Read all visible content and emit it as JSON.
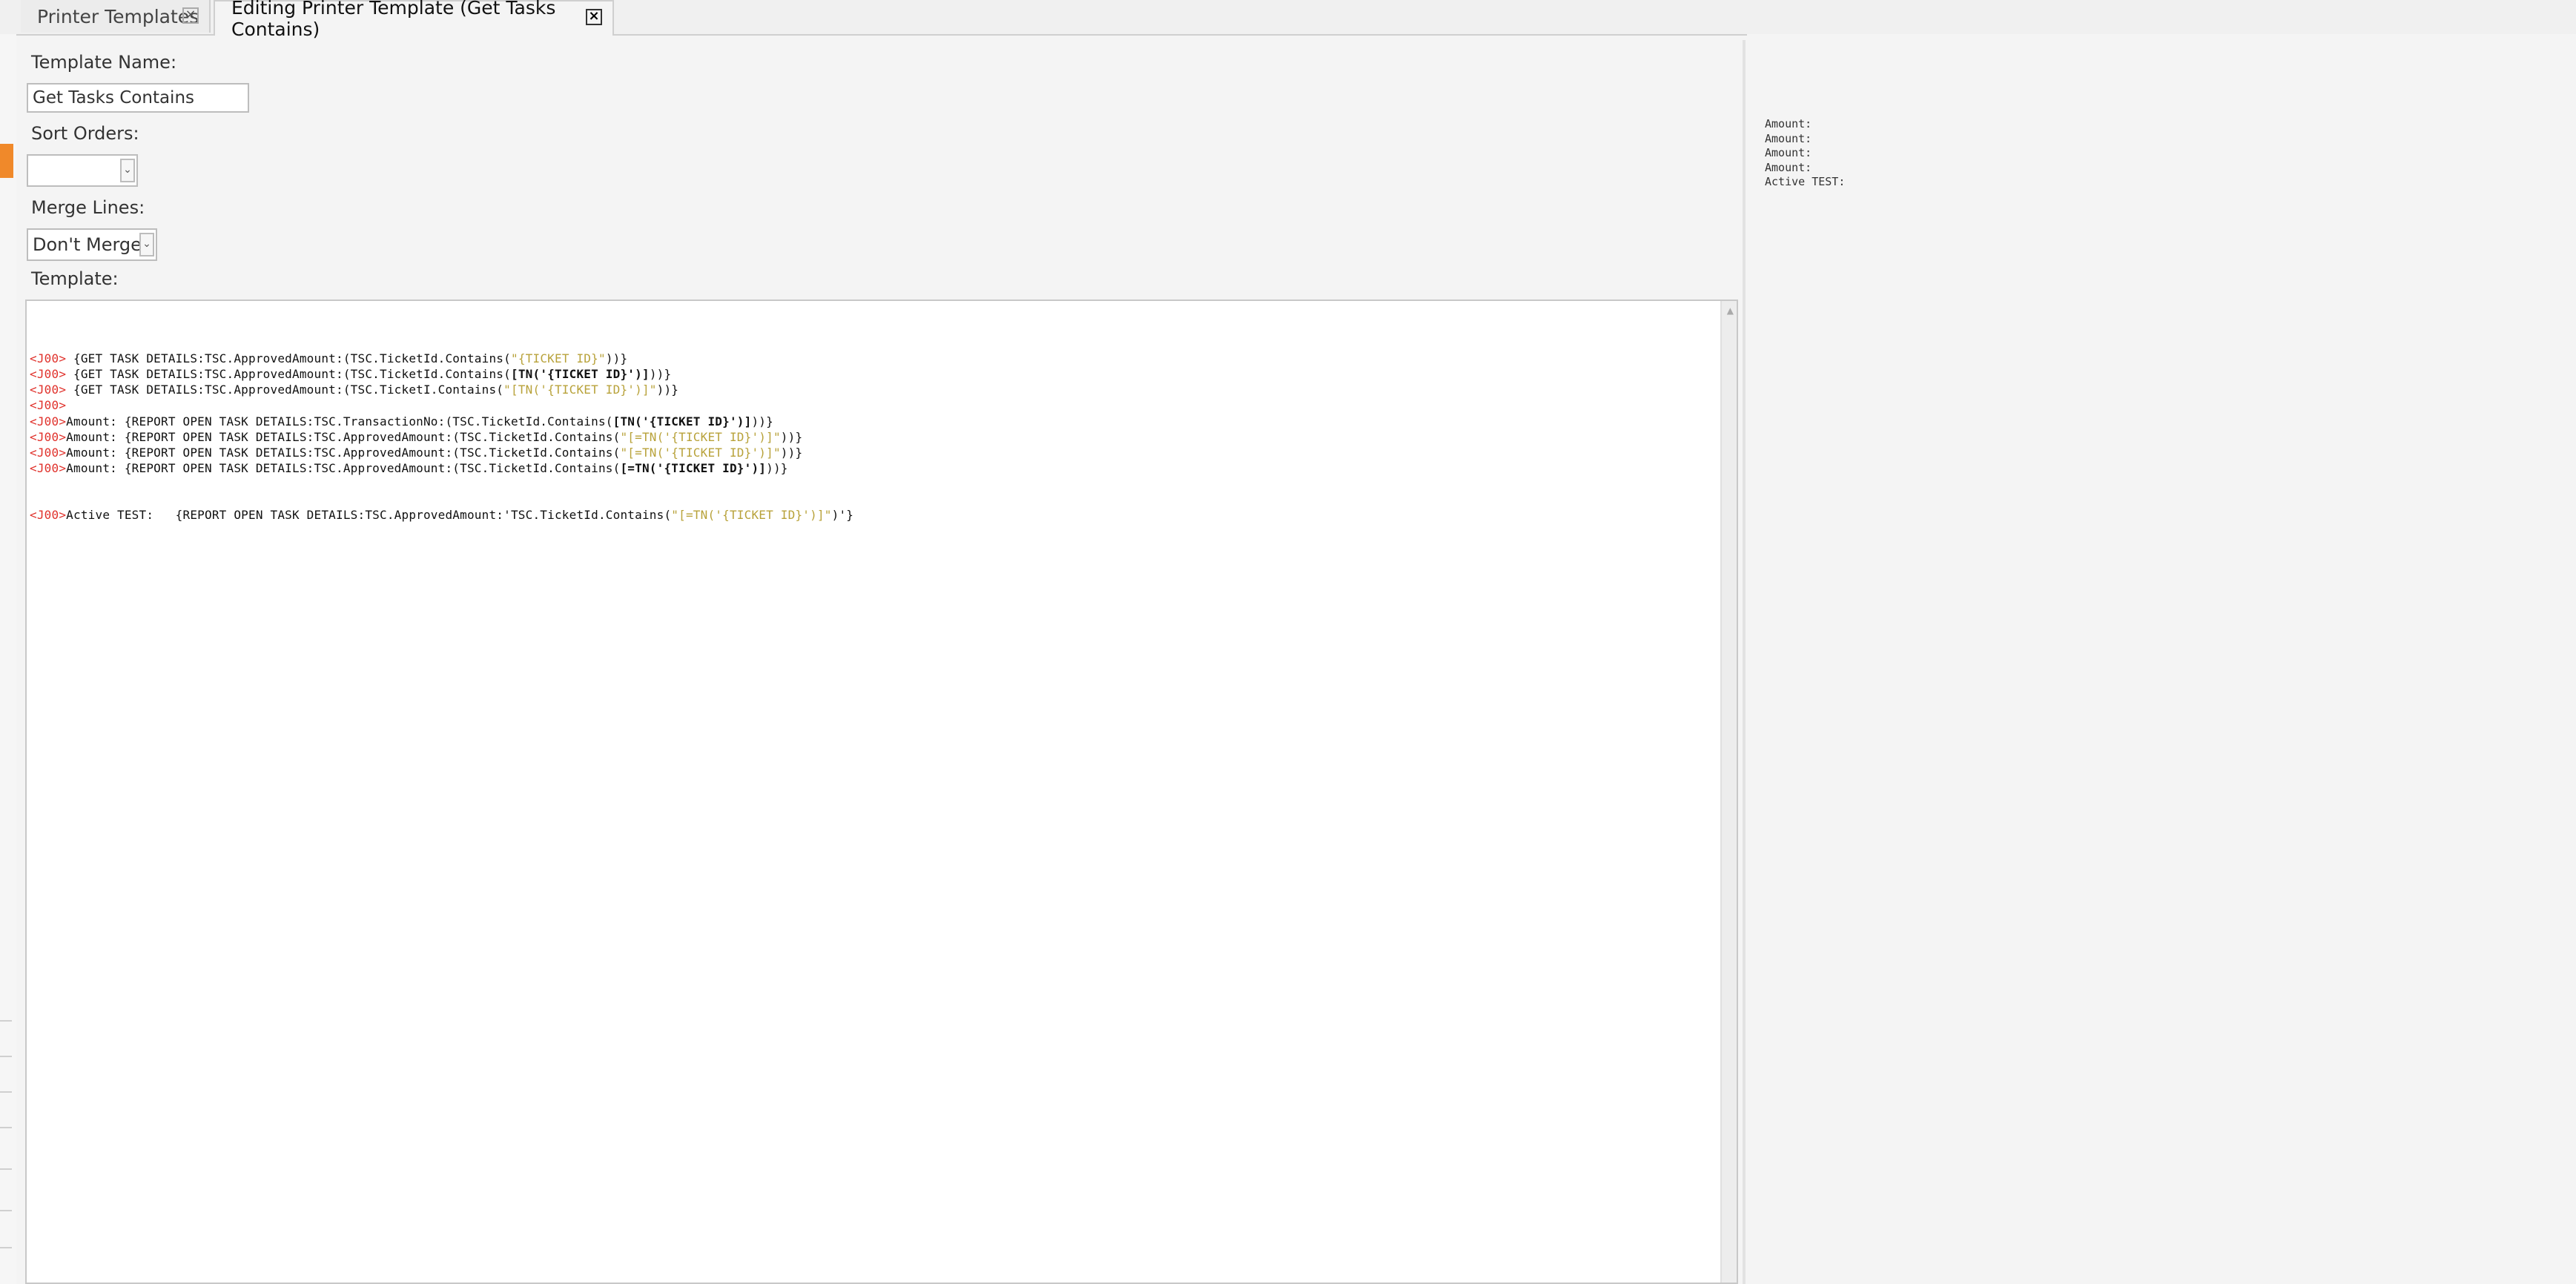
{
  "tabs": [
    {
      "label": "Printer Templates",
      "active": false
    },
    {
      "label": "Editing Printer Template (Get Tasks Contains)",
      "active": true
    }
  ],
  "form": {
    "template_name_label": "Template Name:",
    "template_name_value": "Get Tasks Contains",
    "sort_orders_label": "Sort Orders:",
    "sort_orders_value": "",
    "merge_lines_label": "Merge Lines:",
    "merge_lines_value": "Don't Merge",
    "template_label": "Template:"
  },
  "editor": {
    "lines": [
      [
        {
          "t": "<J00>",
          "c": "tag"
        },
        {
          "t": " {GET TASK DETAILS:TSC.ApprovedAmount:(TSC.TicketId.Contains("
        },
        {
          "t": "\"{TICKET ID}\"",
          "c": "str"
        },
        {
          "t": "))}"
        }
      ],
      [
        {
          "t": "<J00>",
          "c": "tag"
        },
        {
          "t": " {GET TASK DETAILS:TSC.ApprovedAmount:(TSC.TicketId.Contains("
        },
        {
          "t": "[TN('{TICKET ID}')]",
          "c": "b"
        },
        {
          "t": "))}"
        }
      ],
      [
        {
          "t": "<J00>",
          "c": "tag"
        },
        {
          "t": " {GET TASK DETAILS:TSC.ApprovedAmount:(TSC.TicketI.Contains("
        },
        {
          "t": "\"[TN('{TICKET ID}')]\"",
          "c": "str"
        },
        {
          "t": "))}"
        }
      ],
      [
        {
          "t": "<J00>",
          "c": "tag"
        }
      ],
      [
        {
          "t": "<J00>",
          "c": "tag"
        },
        {
          "t": "Amount: {REPORT OPEN TASK DETAILS:TSC.TransactionNo:(TSC.TicketId.Contains("
        },
        {
          "t": "[TN('{TICKET ID}')]",
          "c": "b"
        },
        {
          "t": "))}"
        }
      ],
      [
        {
          "t": "<J00>",
          "c": "tag"
        },
        {
          "t": "Amount: {REPORT OPEN TASK DETAILS:TSC.ApprovedAmount:(TSC.TicketId.Contains("
        },
        {
          "t": "\"[=TN('{TICKET ID}')]\"",
          "c": "str"
        },
        {
          "t": "))}"
        }
      ],
      [
        {
          "t": "<J00>",
          "c": "tag"
        },
        {
          "t": "Amount: {REPORT OPEN TASK DETAILS:TSC.ApprovedAmount:(TSC.TicketId.Contains("
        },
        {
          "t": "\"[=TN('{TICKET ID}')]\"",
          "c": "str"
        },
        {
          "t": "))}"
        }
      ],
      [
        {
          "t": "<J00>",
          "c": "tag"
        },
        {
          "t": "Amount: {REPORT OPEN TASK DETAILS:TSC.ApprovedAmount:(TSC.TicketId.Contains("
        },
        {
          "t": "[=TN('{TICKET ID}')]",
          "c": "b"
        },
        {
          "t": "))}"
        }
      ],
      [
        {
          "t": "<J00>",
          "c": "tag"
        },
        {
          "t": "Active TEST:   {REPORT OPEN TASK DETAILS:TSC.ApprovedAmount:'TSC.TicketId.Contains("
        },
        {
          "t": "\"[=TN('{TICKET ID}')]\"",
          "c": "str"
        },
        {
          "t": ")'}"
        }
      ]
    ]
  },
  "preview": {
    "lines": [
      "Amount:",
      "Amount:",
      "Amount:",
      "Amount:",
      "Active TEST:"
    ]
  },
  "colors": {
    "accent": "#f0892a",
    "tag": "#e0312b",
    "string": "#b8a23a"
  }
}
